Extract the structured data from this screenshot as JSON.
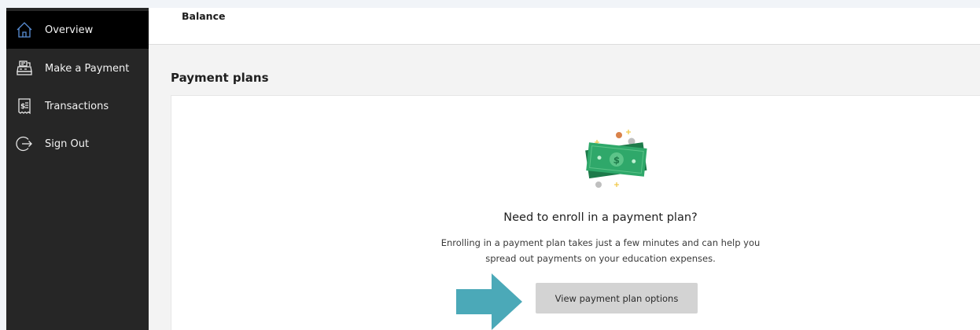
{
  "sidebar": {
    "items": [
      {
        "label": "Overview",
        "icon": "home-icon",
        "active": true
      },
      {
        "label": "Make a Payment",
        "icon": "cash-register-icon",
        "active": false
      },
      {
        "label": "Transactions",
        "icon": "receipt-icon",
        "active": false
      },
      {
        "label": "Sign Out",
        "icon": "sign-out-icon",
        "active": false
      }
    ]
  },
  "header": {
    "title": "Balance"
  },
  "payment_plans": {
    "section_title": "Payment plans",
    "heading": "Need to enroll in a payment plan?",
    "description_line1": "Enrolling in a payment plan takes just a few minutes and can help you",
    "description_line2": "spread out payments on your education expenses.",
    "button_label": "View payment plan options",
    "illustration": "money-bills-icon"
  },
  "colors": {
    "sidebar_bg": "#262626",
    "sidebar_active_bg": "#000000",
    "money_green": "#2fa86a",
    "button_bg": "#d3d3d3",
    "arrow_teal": "#4ba9b8"
  }
}
